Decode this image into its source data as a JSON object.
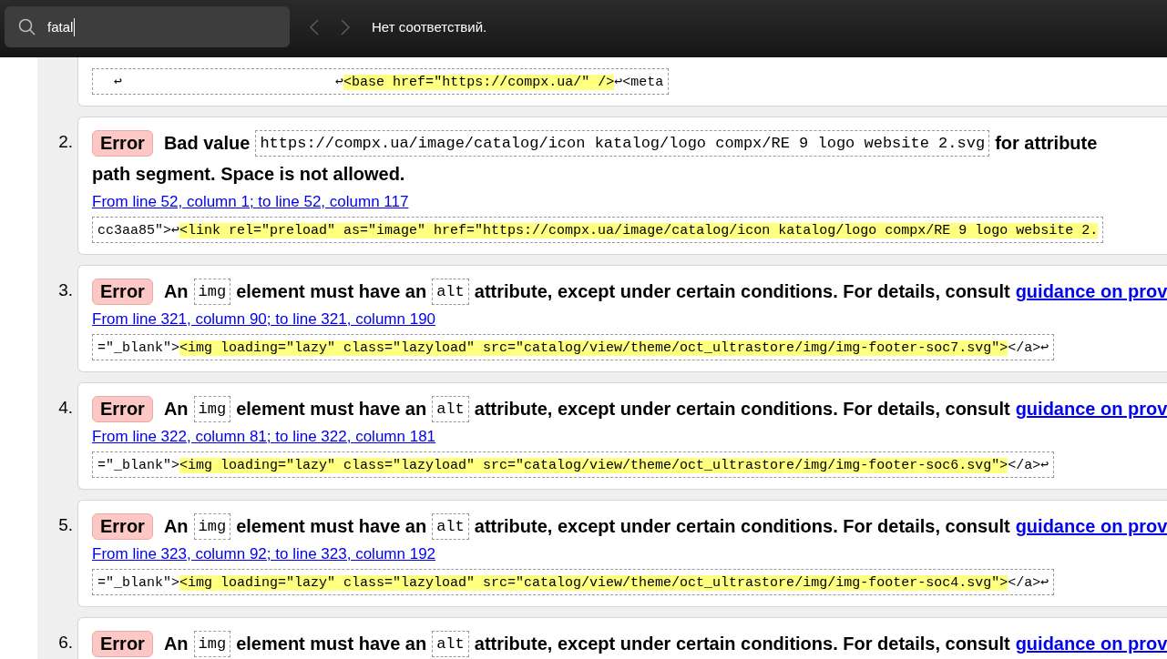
{
  "find_bar": {
    "search": {
      "value": "fatal"
    },
    "previous_disabled": true,
    "next_disabled": true,
    "status": "Нет соответствий."
  },
  "messages": [
    {
      "extract": [
        {
          "kind": "plain",
          "text": "  ↩                          ↩"
        },
        {
          "kind": "mark",
          "text": "<base href=\"https://compx.ua/\" />"
        },
        {
          "kind": "plain",
          "text": "↩<meta"
        }
      ]
    },
    {
      "number": "2.",
      "badge": "Error",
      "lines": [
        [
          {
            "kind": "text",
            "text": "Bad value"
          },
          {
            "kind": "code",
            "text": "https://compx.ua/image/catalog/icon katalog/logo compx/RE 9 logo website 2.svg"
          },
          {
            "kind": "text",
            "text": "for attribute"
          }
        ],
        [
          {
            "kind": "text",
            "text": "path segment. Space is not allowed."
          }
        ]
      ],
      "location": "From line 52, column 1; to line 52, column 117",
      "extract": [
        {
          "kind": "plain",
          "text": "cc3aa85\">↩"
        },
        {
          "kind": "mark",
          "text": "<link rel=\"preload\" as=\"image\" href=\"https://compx.ua/image/catalog/icon katalog/logo compx/RE 9 logo website 2."
        }
      ]
    },
    {
      "number": "3.",
      "badge": "Error",
      "lines": [
        [
          {
            "kind": "text",
            "text": "An"
          },
          {
            "kind": "code",
            "text": "img"
          },
          {
            "kind": "text",
            "text": "element must have an"
          },
          {
            "kind": "code",
            "text": "alt"
          },
          {
            "kind": "text",
            "text": "attribute, except under certain conditions. For details, consult"
          },
          {
            "kind": "link",
            "text": "guidance on prov"
          }
        ]
      ],
      "location": "From line 321, column 90; to line 321, column 190",
      "extract": [
        {
          "kind": "plain",
          "text": "=\"_blank\">"
        },
        {
          "kind": "mark",
          "text": "<img loading=\"lazy\" class=\"lazyload\" src=\"catalog/view/theme/oct_ultrastore/img/img-footer-soc7.svg\">"
        },
        {
          "kind": "plain",
          "text": "</a>↩"
        }
      ]
    },
    {
      "number": "4.",
      "badge": "Error",
      "lines": [
        [
          {
            "kind": "text",
            "text": "An"
          },
          {
            "kind": "code",
            "text": "img"
          },
          {
            "kind": "text",
            "text": "element must have an"
          },
          {
            "kind": "code",
            "text": "alt"
          },
          {
            "kind": "text",
            "text": "attribute, except under certain conditions. For details, consult"
          },
          {
            "kind": "link",
            "text": "guidance on prov"
          }
        ]
      ],
      "location": "From line 322, column 81; to line 322, column 181",
      "extract": [
        {
          "kind": "plain",
          "text": "=\"_blank\">"
        },
        {
          "kind": "mark",
          "text": "<img loading=\"lazy\" class=\"lazyload\" src=\"catalog/view/theme/oct_ultrastore/img/img-footer-soc6.svg\">"
        },
        {
          "kind": "plain",
          "text": "</a>↩"
        }
      ]
    },
    {
      "number": "5.",
      "badge": "Error",
      "lines": [
        [
          {
            "kind": "text",
            "text": "An"
          },
          {
            "kind": "code",
            "text": "img"
          },
          {
            "kind": "text",
            "text": "element must have an"
          },
          {
            "kind": "code",
            "text": "alt"
          },
          {
            "kind": "text",
            "text": "attribute, except under certain conditions. For details, consult"
          },
          {
            "kind": "link",
            "text": "guidance on prov"
          }
        ]
      ],
      "location": "From line 323, column 92; to line 323, column 192",
      "extract": [
        {
          "kind": "plain",
          "text": "=\"_blank\">"
        },
        {
          "kind": "mark",
          "text": "<img loading=\"lazy\" class=\"lazyload\" src=\"catalog/view/theme/oct_ultrastore/img/img-footer-soc4.svg\">"
        },
        {
          "kind": "plain",
          "text": "</a>↩"
        }
      ]
    },
    {
      "number": "6.",
      "badge": "Error",
      "lines": [
        [
          {
            "kind": "text",
            "text": "An"
          },
          {
            "kind": "code",
            "text": "img"
          },
          {
            "kind": "text",
            "text": "element must have an"
          },
          {
            "kind": "code",
            "text": "alt"
          },
          {
            "kind": "text",
            "text": "attribute, except under certain conditions. For details, consult"
          },
          {
            "kind": "link",
            "text": "guidance on prov"
          }
        ]
      ]
    }
  ]
}
